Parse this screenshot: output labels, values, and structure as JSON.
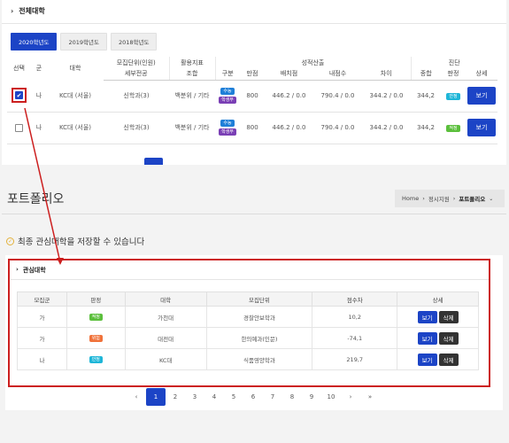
{
  "top": {
    "section_title": "전체대학",
    "year_tabs": [
      "2020학년도",
      "2019학년도",
      "2018학년도"
    ],
    "headers": {
      "select": "선택",
      "group": "군",
      "univ": "대학",
      "unit_top": "모집단위(인원)",
      "unit_bottom": "세부전공",
      "index_top": "활용지표",
      "index_bottom": "조합",
      "calc_group": "성적산출",
      "diag_group": "진단",
      "kind": "구분",
      "full": "만점",
      "alloc": "배치점",
      "mine": "내점수",
      "diff": "차이",
      "total": "종합",
      "verdict": "판정",
      "detail": "상세"
    },
    "rows": [
      {
        "group": "나",
        "univ": "KC대 (서울)",
        "unit": "신학과(3)",
        "index": "백분위 / 기타",
        "badge1": "수능",
        "badge2": "학생부",
        "full": "800",
        "alloc": "446.2 / 0.0",
        "mine": "790.4 / 0.0",
        "diff": "344.2 / 0.0",
        "total": "344,2",
        "verdict": "안정",
        "btn": "보기",
        "checked": true
      },
      {
        "group": "나",
        "univ": "KC대 (서울)",
        "unit": "신학과(3)",
        "index": "백분위 / 기타",
        "badge1": "수능",
        "badge2": "학생부",
        "full": "800",
        "alloc": "446.2 / 0.0",
        "mine": "790.4 / 0.0",
        "diff": "344.2 / 0.0",
        "total": "344,2",
        "verdict": "적정",
        "btn": "보기",
        "checked": false
      }
    ],
    "check_mark": "✔"
  },
  "portfolio": {
    "title": "포트폴리오",
    "breadcrumb": [
      "Home",
      "정시지원",
      "포트폴리오"
    ],
    "breadcrumb_sep": "›",
    "notice": "최종 관심대학을 저장할 수 있습니다",
    "section_title": "관심대학",
    "headers": [
      "모집군",
      "판정",
      "대학",
      "모집단위",
      "점수차",
      "상세"
    ],
    "rows": [
      {
        "group": "가",
        "verdict": "적정",
        "verdict_color": "#5bbf3c",
        "univ": "가천대",
        "unit": "경찰안보학과",
        "diff": "10,2"
      },
      {
        "group": "가",
        "verdict": "위험",
        "verdict_color": "#f0723a",
        "univ": "대전대",
        "unit": "한의예과(인문)",
        "diff": "-74,1"
      },
      {
        "group": "나",
        "verdict": "안정",
        "verdict_color": "#1eb6d8",
        "univ": "KC대",
        "unit": "식품영양학과",
        "diff": "219,7"
      }
    ],
    "btn_view": "보기",
    "btn_delete": "삭제"
  },
  "pager": {
    "prev": "‹",
    "pages": [
      "1",
      "2",
      "3",
      "4",
      "5",
      "6",
      "7",
      "8",
      "9",
      "10"
    ],
    "active": "1",
    "next": "›",
    "last": "»"
  },
  "colors": {
    "accent": "#1c44c6",
    "highlight_red": "#cc1f1f"
  },
  "icons": {
    "section": "chevron-right-icon",
    "notice": "check-circle-icon",
    "breadcrumb": "chevron-down-icon"
  }
}
